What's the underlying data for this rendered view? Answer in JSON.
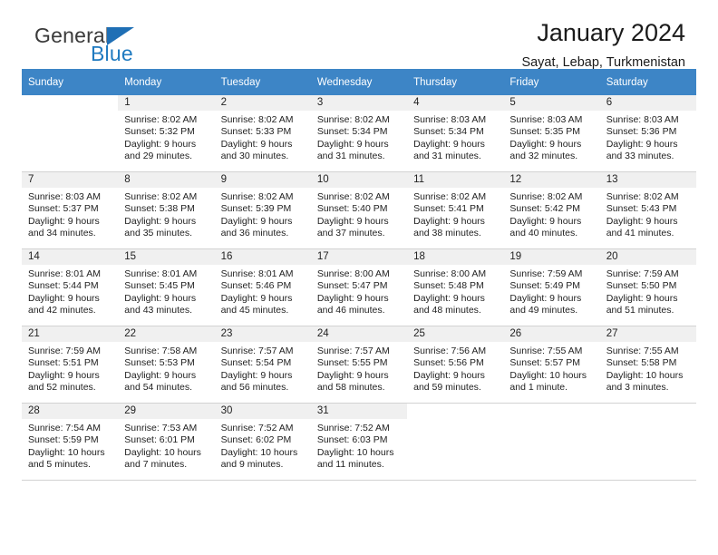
{
  "brand": {
    "name_part1": "General",
    "name_part2": "Blue",
    "triangle_color": "#1f6fb5",
    "blue_color": "#1f7ac0"
  },
  "header": {
    "title": "January 2024",
    "subtitle": "Sayat, Lebap, Turkmenistan"
  },
  "theme": {
    "header_row_bg": "#3d85c6",
    "header_row_text": "#ffffff",
    "daynum_bar_bg": "#f0f0f0",
    "grid_line": "#d2d2d2"
  },
  "weekdays": [
    "Sunday",
    "Monday",
    "Tuesday",
    "Wednesday",
    "Thursday",
    "Friday",
    "Saturday"
  ],
  "labels": {
    "sunrise_prefix": "Sunrise:",
    "sunset_prefix": "Sunset:",
    "daylight_prefix": "Daylight:"
  },
  "weeks": [
    [
      {
        "day": "",
        "sunrise": "",
        "sunset": "",
        "daylight": "",
        "empty": true
      },
      {
        "day": "1",
        "sunrise": "Sunrise: 8:02 AM",
        "sunset": "Sunset: 5:32 PM",
        "daylight": "Daylight: 9 hours and 29 minutes."
      },
      {
        "day": "2",
        "sunrise": "Sunrise: 8:02 AM",
        "sunset": "Sunset: 5:33 PM",
        "daylight": "Daylight: 9 hours and 30 minutes."
      },
      {
        "day": "3",
        "sunrise": "Sunrise: 8:02 AM",
        "sunset": "Sunset: 5:34 PM",
        "daylight": "Daylight: 9 hours and 31 minutes."
      },
      {
        "day": "4",
        "sunrise": "Sunrise: 8:03 AM",
        "sunset": "Sunset: 5:34 PM",
        "daylight": "Daylight: 9 hours and 31 minutes."
      },
      {
        "day": "5",
        "sunrise": "Sunrise: 8:03 AM",
        "sunset": "Sunset: 5:35 PM",
        "daylight": "Daylight: 9 hours and 32 minutes."
      },
      {
        "day": "6",
        "sunrise": "Sunrise: 8:03 AM",
        "sunset": "Sunset: 5:36 PM",
        "daylight": "Daylight: 9 hours and 33 minutes."
      }
    ],
    [
      {
        "day": "7",
        "sunrise": "Sunrise: 8:03 AM",
        "sunset": "Sunset: 5:37 PM",
        "daylight": "Daylight: 9 hours and 34 minutes."
      },
      {
        "day": "8",
        "sunrise": "Sunrise: 8:02 AM",
        "sunset": "Sunset: 5:38 PM",
        "daylight": "Daylight: 9 hours and 35 minutes."
      },
      {
        "day": "9",
        "sunrise": "Sunrise: 8:02 AM",
        "sunset": "Sunset: 5:39 PM",
        "daylight": "Daylight: 9 hours and 36 minutes."
      },
      {
        "day": "10",
        "sunrise": "Sunrise: 8:02 AM",
        "sunset": "Sunset: 5:40 PM",
        "daylight": "Daylight: 9 hours and 37 minutes."
      },
      {
        "day": "11",
        "sunrise": "Sunrise: 8:02 AM",
        "sunset": "Sunset: 5:41 PM",
        "daylight": "Daylight: 9 hours and 38 minutes."
      },
      {
        "day": "12",
        "sunrise": "Sunrise: 8:02 AM",
        "sunset": "Sunset: 5:42 PM",
        "daylight": "Daylight: 9 hours and 40 minutes."
      },
      {
        "day": "13",
        "sunrise": "Sunrise: 8:02 AM",
        "sunset": "Sunset: 5:43 PM",
        "daylight": "Daylight: 9 hours and 41 minutes."
      }
    ],
    [
      {
        "day": "14",
        "sunrise": "Sunrise: 8:01 AM",
        "sunset": "Sunset: 5:44 PM",
        "daylight": "Daylight: 9 hours and 42 minutes."
      },
      {
        "day": "15",
        "sunrise": "Sunrise: 8:01 AM",
        "sunset": "Sunset: 5:45 PM",
        "daylight": "Daylight: 9 hours and 43 minutes."
      },
      {
        "day": "16",
        "sunrise": "Sunrise: 8:01 AM",
        "sunset": "Sunset: 5:46 PM",
        "daylight": "Daylight: 9 hours and 45 minutes."
      },
      {
        "day": "17",
        "sunrise": "Sunrise: 8:00 AM",
        "sunset": "Sunset: 5:47 PM",
        "daylight": "Daylight: 9 hours and 46 minutes."
      },
      {
        "day": "18",
        "sunrise": "Sunrise: 8:00 AM",
        "sunset": "Sunset: 5:48 PM",
        "daylight": "Daylight: 9 hours and 48 minutes."
      },
      {
        "day": "19",
        "sunrise": "Sunrise: 7:59 AM",
        "sunset": "Sunset: 5:49 PM",
        "daylight": "Daylight: 9 hours and 49 minutes."
      },
      {
        "day": "20",
        "sunrise": "Sunrise: 7:59 AM",
        "sunset": "Sunset: 5:50 PM",
        "daylight": "Daylight: 9 hours and 51 minutes."
      }
    ],
    [
      {
        "day": "21",
        "sunrise": "Sunrise: 7:59 AM",
        "sunset": "Sunset: 5:51 PM",
        "daylight": "Daylight: 9 hours and 52 minutes."
      },
      {
        "day": "22",
        "sunrise": "Sunrise: 7:58 AM",
        "sunset": "Sunset: 5:53 PM",
        "daylight": "Daylight: 9 hours and 54 minutes."
      },
      {
        "day": "23",
        "sunrise": "Sunrise: 7:57 AM",
        "sunset": "Sunset: 5:54 PM",
        "daylight": "Daylight: 9 hours and 56 minutes."
      },
      {
        "day": "24",
        "sunrise": "Sunrise: 7:57 AM",
        "sunset": "Sunset: 5:55 PM",
        "daylight": "Daylight: 9 hours and 58 minutes."
      },
      {
        "day": "25",
        "sunrise": "Sunrise: 7:56 AM",
        "sunset": "Sunset: 5:56 PM",
        "daylight": "Daylight: 9 hours and 59 minutes."
      },
      {
        "day": "26",
        "sunrise": "Sunrise: 7:55 AM",
        "sunset": "Sunset: 5:57 PM",
        "daylight": "Daylight: 10 hours and 1 minute."
      },
      {
        "day": "27",
        "sunrise": "Sunrise: 7:55 AM",
        "sunset": "Sunset: 5:58 PM",
        "daylight": "Daylight: 10 hours and 3 minutes."
      }
    ],
    [
      {
        "day": "28",
        "sunrise": "Sunrise: 7:54 AM",
        "sunset": "Sunset: 5:59 PM",
        "daylight": "Daylight: 10 hours and 5 minutes."
      },
      {
        "day": "29",
        "sunrise": "Sunrise: 7:53 AM",
        "sunset": "Sunset: 6:01 PM",
        "daylight": "Daylight: 10 hours and 7 minutes."
      },
      {
        "day": "30",
        "sunrise": "Sunrise: 7:52 AM",
        "sunset": "Sunset: 6:02 PM",
        "daylight": "Daylight: 10 hours and 9 minutes."
      },
      {
        "day": "31",
        "sunrise": "Sunrise: 7:52 AM",
        "sunset": "Sunset: 6:03 PM",
        "daylight": "Daylight: 10 hours and 11 minutes."
      },
      {
        "day": "",
        "sunrise": "",
        "sunset": "",
        "daylight": "",
        "empty": true
      },
      {
        "day": "",
        "sunrise": "",
        "sunset": "",
        "daylight": "",
        "empty": true
      },
      {
        "day": "",
        "sunrise": "",
        "sunset": "",
        "daylight": "",
        "empty": true
      }
    ]
  ]
}
